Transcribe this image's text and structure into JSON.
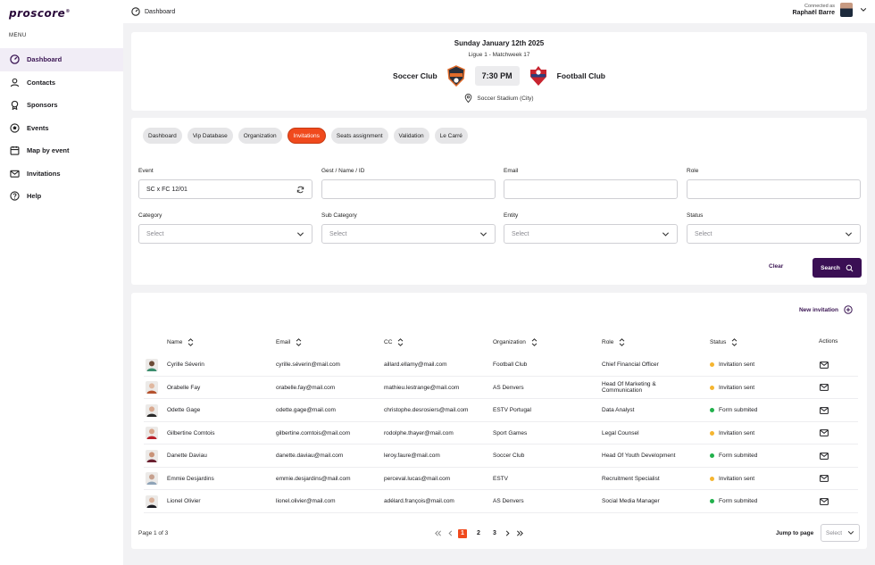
{
  "brand": {
    "logo": "proscore",
    "mark": "®",
    "accent": "#f04a1d",
    "primary": "#3a0f54"
  },
  "sidebar": {
    "menu_title": "MENU",
    "items": [
      {
        "label": "Dashboard",
        "icon": "dashboard-gauge-icon",
        "active": true
      },
      {
        "label": "Contacts",
        "icon": "user-icon"
      },
      {
        "label": "Sponsors",
        "icon": "award-ribbon-icon"
      },
      {
        "label": "Events",
        "icon": "soccer-ball-icon"
      },
      {
        "label": "Map by event",
        "icon": "calendar-icon"
      },
      {
        "label": "Invitations",
        "icon": "mail-icon"
      },
      {
        "label": "Help",
        "icon": "question-circle-icon"
      }
    ]
  },
  "topbar": {
    "breadcrumb": "Dashboard",
    "connected_as": "Connected as",
    "user_name": "Raphaël Barre"
  },
  "match": {
    "date": "Sunday January 12th 2025",
    "league": "Ligue 1 - Matchweek 17",
    "home_team": "Soccer Club",
    "away_team": "Football Club",
    "time": "7:30 PM",
    "venue": "Soccer Stadium (City)"
  },
  "tabs": [
    {
      "label": "Dashboard"
    },
    {
      "label": "Vip Database"
    },
    {
      "label": "Organization"
    },
    {
      "label": "Invitations",
      "active": true
    },
    {
      "label": "Seats assignment"
    },
    {
      "label": "Validation"
    },
    {
      "label": "Le Carré"
    }
  ],
  "filters": {
    "event": {
      "label": "Event",
      "value": "SC x FC 12/01"
    },
    "guest": {
      "label": "Gest / Name / ID",
      "value": ""
    },
    "email": {
      "label": "Email",
      "value": ""
    },
    "role": {
      "label": "Role",
      "value": ""
    },
    "category": {
      "label": "Category",
      "placeholder": "Select"
    },
    "sub_category": {
      "label": "Sub Category",
      "placeholder": "Select"
    },
    "entity": {
      "label": "Entity",
      "placeholder": "Select"
    },
    "status": {
      "label": "Status",
      "placeholder": "Select"
    },
    "clear_label": "Clear",
    "search_label": "Search"
  },
  "table": {
    "new_invitation": "New invitation",
    "columns": [
      "Name",
      "Email",
      "CC",
      "Organization",
      "Role",
      "Status",
      "Actions"
    ],
    "status_colors": {
      "Invitation sent": "#f5b530",
      "Form submited": "#22b14c"
    },
    "rows": [
      {
        "name": "Cyrille Séverin",
        "email": "cyrille.séverin@mail.com",
        "cc": "aillard.ellamy@mail.com",
        "org": "Football Club",
        "role": "Chief Financial Officer",
        "status": "Invitation sent",
        "skin": "#6b4a36",
        "shirt": "#3b8d6e"
      },
      {
        "name": "Orabelle Fay",
        "email": "orabelle.fay@mail.com",
        "cc": "mathieu.lestrange@mail.com",
        "org": "AS Denvers",
        "role": "Head Of Marketing & Communication",
        "status": "Invitation sent",
        "skin": "#e0b8a0",
        "shirt": "#b5522e"
      },
      {
        "name": "Odette Gage",
        "email": "odette.gage@mail.com",
        "cc": "christophe.desrosiers@mail.com",
        "org": "ESTV Portugal",
        "role": "Data Analyst",
        "status": "Form submited",
        "skin": "#d9a98f",
        "shirt": "#2a2a2a"
      },
      {
        "name": "Gilbertine Comtois",
        "email": "gilbertine.comtois@mail.com",
        "cc": "rodolphe.thayer@mail.com",
        "org": "Sport Games",
        "role": "Legal Counsel",
        "status": "Invitation sent",
        "skin": "#d8a58a",
        "shirt": "#b8202a"
      },
      {
        "name": "Danette Daviau",
        "email": "danette.daviau@mail.com",
        "cc": "leroy.faure@mail.com",
        "org": "Soccer Club",
        "role": "Head Of Youth Development",
        "status": "Form submited",
        "skin": "#c99378",
        "shirt": "#6b2030"
      },
      {
        "name": "Emmie Desjardins",
        "email": "emmie.desjardins@mail.com",
        "cc": "perceval.lucas@mail.com",
        "org": "ESTV",
        "role": "Recruitment Specialist",
        "status": "Invitation sent",
        "skin": "#c6a08e",
        "shirt": "#8fa4b8"
      },
      {
        "name": "Lionel Olivier",
        "email": "lionel.olivier@mail.com",
        "cc": "adélard.françois@mail.com",
        "org": "AS Denvers",
        "role": "Social Media Manager",
        "status": "Form submited",
        "skin": "#d9b19a",
        "shirt": "#1d1d24"
      }
    ]
  },
  "pagination": {
    "info": "Page 1 of 3",
    "pages": [
      "1",
      "2",
      "3"
    ],
    "current": "1",
    "jump_label": "Jump to page",
    "jump_placeholder": "Select"
  }
}
